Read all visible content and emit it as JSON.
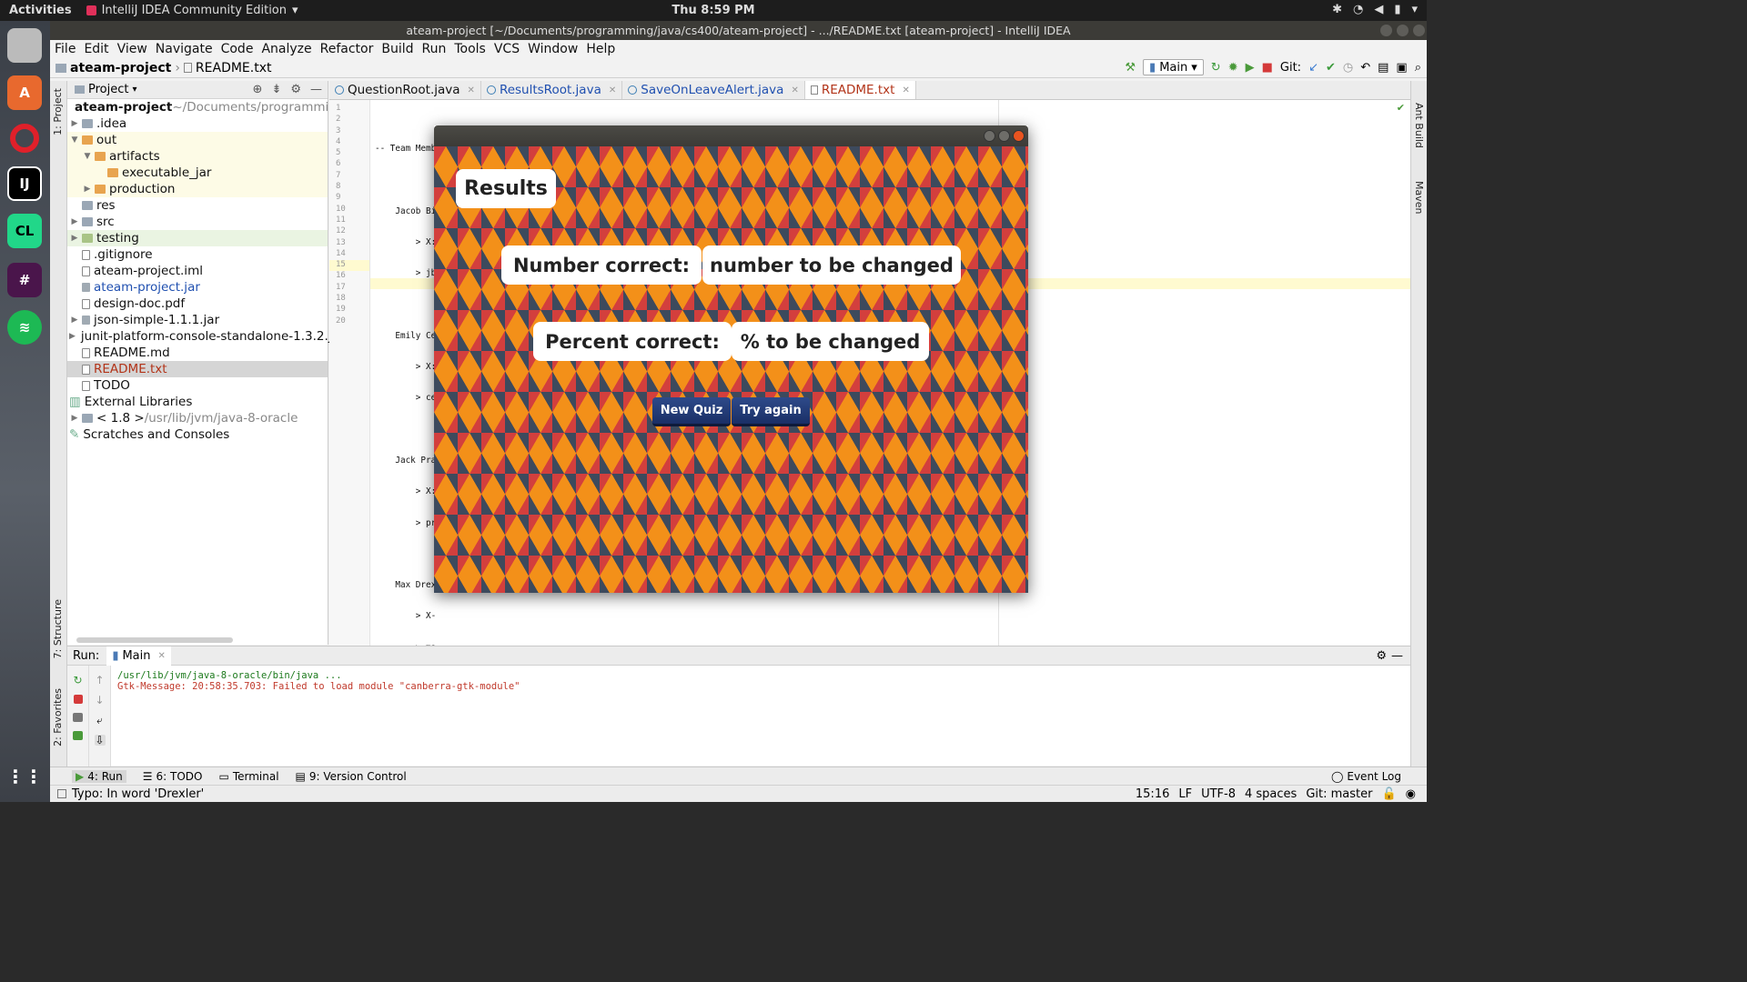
{
  "desktop": {
    "activities": "Activities",
    "app_name": "IntelliJ IDEA Community Edition",
    "clock": "Thu  8:59 PM"
  },
  "window": {
    "title": "ateam-project [~/Documents/programming/java/cs400/ateam-project] - .../README.txt [ateam-project] - IntelliJ IDEA"
  },
  "menu": [
    "File",
    "Edit",
    "View",
    "Navigate",
    "Code",
    "Analyze",
    "Refactor",
    "Build",
    "Run",
    "Tools",
    "VCS",
    "Window",
    "Help"
  ],
  "nav": {
    "project": "ateam-project",
    "file": "README.txt",
    "run_config": "Main",
    "git_label": "Git:"
  },
  "side": {
    "project": "1: Project",
    "structure": "7: Structure",
    "favorites": "2: Favorites",
    "ant": "Ant Build",
    "maven": "Maven"
  },
  "project_panel": {
    "header": "Project",
    "tree": [
      {
        "label": "ateam-project",
        "hint": " ~/Documents/programmin"
      },
      {
        "label": ".idea"
      },
      {
        "label": "out"
      },
      {
        "label": "artifacts"
      },
      {
        "label": "executable_jar"
      },
      {
        "label": "production"
      },
      {
        "label": "res"
      },
      {
        "label": "src"
      },
      {
        "label": "testing"
      },
      {
        "label": ".gitignore"
      },
      {
        "label": "ateam-project.iml"
      },
      {
        "label": "ateam-project.jar"
      },
      {
        "label": "design-doc.pdf"
      },
      {
        "label": "json-simple-1.1.1.jar"
      },
      {
        "label": "junit-platform-console-standalone-1.3.2.ja"
      },
      {
        "label": "README.md"
      },
      {
        "label": "README.txt"
      },
      {
        "label": "TODO"
      },
      {
        "label": "External Libraries"
      },
      {
        "label": "< 1.8 >",
        "hint": " /usr/lib/jvm/java-8-oracle"
      },
      {
        "label": "Scratches and Consoles"
      }
    ]
  },
  "tabs": [
    "QuestionRoot.java",
    "ResultsRoot.java",
    "SaveOnLeaveAlert.java",
    "README.txt"
  ],
  "editor": {
    "line_numbers": [
      "1",
      "2",
      "3",
      "4",
      "5",
      "6",
      "7",
      "8",
      "9",
      "10",
      "11",
      "12",
      "13",
      "14",
      "15",
      "16",
      "17",
      "18",
      "19",
      "20"
    ],
    "lines": [
      "-- Team Member Information : A-team 13 --",
      "",
      "    Jacob Bi",
      "        > X:",
      "        > jb",
      "",
      "    Emily Ce",
      "        > X:",
      "        > ce",
      "",
      "    Jack Pra",
      "        > X:",
      "        > pr",
      "",
      "    Max Drex",
      "        > X-",
      "        > ma",
      "",
      "-----------",
      ""
    ]
  },
  "run": {
    "label": "Run:",
    "tab": "Main",
    "line1": "/usr/lib/jvm/java-8-oracle/bin/java ...",
    "line2": "Gtk-Message: 20:58:35.703: Failed to load module \"canberra-gtk-module\""
  },
  "bottom_tabs": [
    "4: Run",
    "6: TODO",
    "Terminal",
    "9: Version Control"
  ],
  "event_log": "Event Log",
  "status": {
    "message": "Typo: In word 'Drexler'",
    "position": "15:16",
    "line_sep": "LF",
    "encoding": "UTF-8",
    "indent": "4 spaces",
    "git": "Git: master"
  },
  "fx": {
    "heading": "Results",
    "num_label": "Number correct:",
    "num_value": "number to be changed",
    "pct_label": "Percent correct:",
    "pct_value": "% to be changed",
    "btn_new": "New Quiz",
    "btn_retry": "Try again"
  }
}
